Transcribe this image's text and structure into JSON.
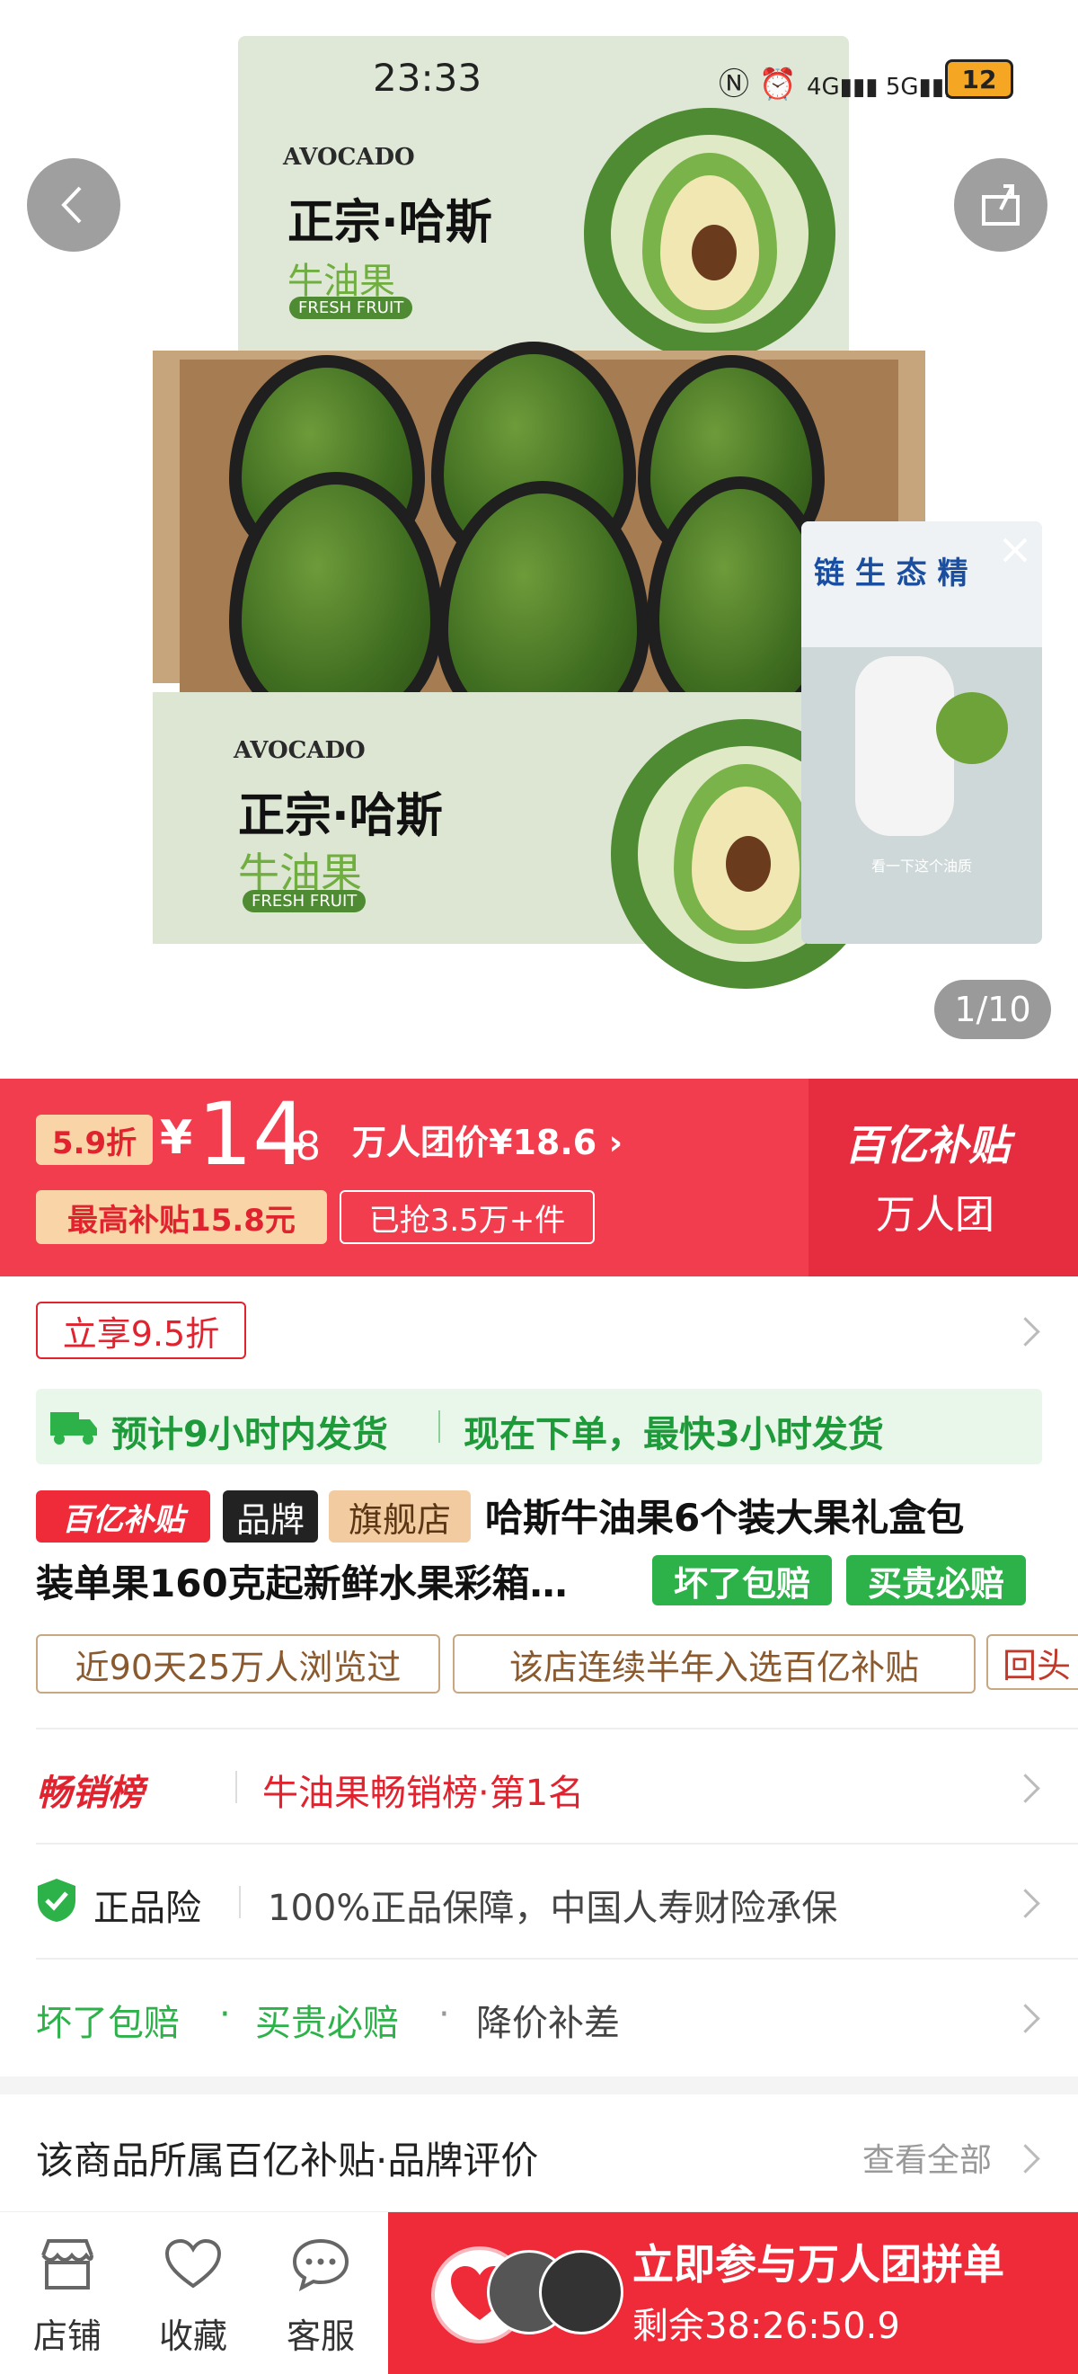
{
  "status_bar": {
    "time": "23:33",
    "battery": "12"
  },
  "hero": {
    "box_brand": "AVOCADO",
    "box_title": "正宗·哈斯",
    "box_fruit": "牛油果",
    "box_fresh": "FRESH FRUIT",
    "image_counter": "1/10",
    "video_banner": "链 生 态   精",
    "video_caption": "看一下这个油质"
  },
  "price_banner": {
    "discount_badge": "5.9折",
    "currency": "¥",
    "price_int": "14",
    "price_dec": ".8",
    "group_price_label": "万人团价¥18.6",
    "subsidy_badge": "最高补贴15.8元",
    "sold_badge": "已抢3.5万+件",
    "brand_logo": "百亿补贴",
    "group_label": "万人团"
  },
  "promo": {
    "coupon": "立享9.5折"
  },
  "shipping": {
    "estimate": "预计9小时内发货",
    "fast": "现在下单，最快3小时发货"
  },
  "title": {
    "tag_subsidy": "百亿补贴",
    "tag_brand": "品牌",
    "tag_flagship": "旗舰店",
    "line1": "哈斯牛油果6个装大果礼盒包",
    "line2": "装单果160克起新鲜水果彩箱…",
    "guarantee1": "坏了包赔",
    "guarantee2": "买贵必赔"
  },
  "highlights": [
    "近90天25万人浏览过",
    "该店连续半年入选百亿补贴",
    "回头"
  ],
  "ranking": {
    "badge": "畅销榜",
    "text": "牛油果畅销榜·第1名"
  },
  "insurance": {
    "label": "正品险",
    "text": "100%正品保障，中国人寿财险承保"
  },
  "services": {
    "item1": "坏了包赔",
    "item2": "买贵必赔",
    "item3": "降价补差",
    "sep": "·"
  },
  "brand_review": {
    "title": "该商品所属百亿补贴·品牌评价",
    "view_all": "查看全部"
  },
  "bottom_bar": {
    "store": "店铺",
    "favorite": "收藏",
    "service": "客服",
    "cta_title": "立即参与万人团拼单",
    "cta_countdown": "剩余38:26:50.9"
  },
  "colors": {
    "brand_red": "#f23d4f",
    "green": "#2db24a",
    "tag_orange": "#f2cba0"
  }
}
